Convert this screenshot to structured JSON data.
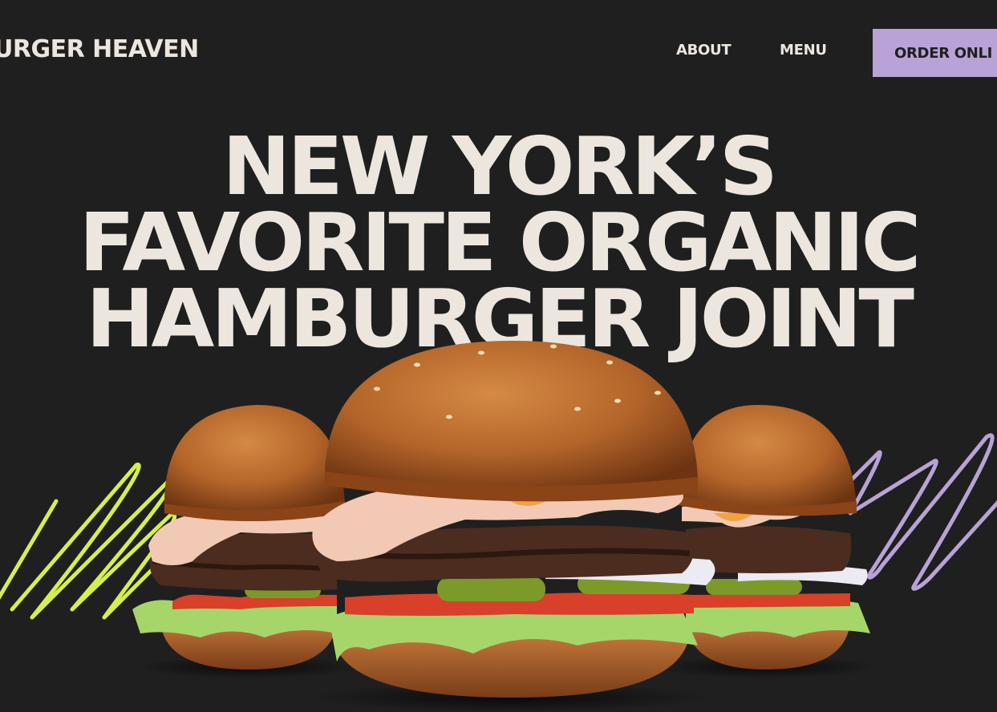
{
  "header": {
    "logo_text": "URGER HEAVEN",
    "nav": {
      "about": "ABOUT",
      "menu": "MENU"
    },
    "order_button": "ORDER ONLI"
  },
  "hero": {
    "title_lines": [
      "NEW YORK’S",
      "FAVORITE ORGANIC",
      "HAMBURGER JOINT"
    ]
  },
  "colors": {
    "background": "#1f1f1f",
    "text": "#ece6df",
    "accent_purple": "#b9a2d6",
    "accent_lime": "#d4f04a"
  },
  "images": {
    "hero_image": "three-burgers-photo"
  }
}
